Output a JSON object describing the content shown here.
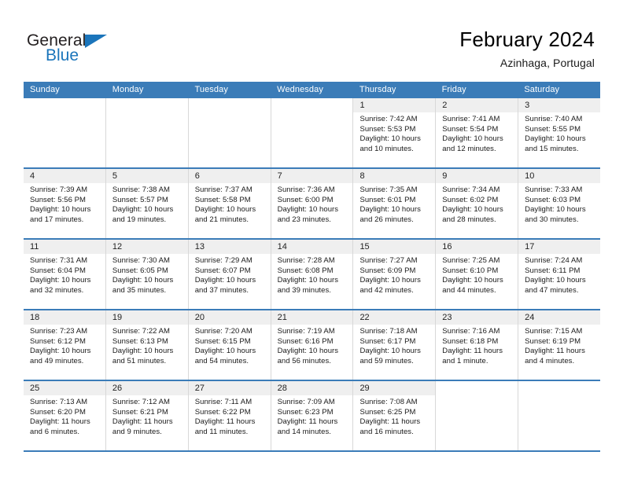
{
  "brand": {
    "name_top": "General",
    "name_bottom": "Blue"
  },
  "header": {
    "title": "February 2024",
    "location": "Azinhaga, Portugal"
  },
  "calendar": {
    "weekday_headers": [
      "Sunday",
      "Monday",
      "Tuesday",
      "Wednesday",
      "Thursday",
      "Friday",
      "Saturday"
    ],
    "colors": {
      "header_blue": "#3b7cb8",
      "daynum_band": "#efefef",
      "brand_blue": "#1b75bb",
      "cell_border": "#d8d8d8"
    },
    "weeks": [
      [
        {
          "day": "",
          "lines": []
        },
        {
          "day": "",
          "lines": []
        },
        {
          "day": "",
          "lines": []
        },
        {
          "day": "",
          "lines": []
        },
        {
          "day": "1",
          "lines": [
            "Sunrise: 7:42 AM",
            "Sunset: 5:53 PM",
            "Daylight: 10 hours and 10 minutes."
          ]
        },
        {
          "day": "2",
          "lines": [
            "Sunrise: 7:41 AM",
            "Sunset: 5:54 PM",
            "Daylight: 10 hours and 12 minutes."
          ]
        },
        {
          "day": "3",
          "lines": [
            "Sunrise: 7:40 AM",
            "Sunset: 5:55 PM",
            "Daylight: 10 hours and 15 minutes."
          ]
        }
      ],
      [
        {
          "day": "4",
          "lines": [
            "Sunrise: 7:39 AM",
            "Sunset: 5:56 PM",
            "Daylight: 10 hours and 17 minutes."
          ]
        },
        {
          "day": "5",
          "lines": [
            "Sunrise: 7:38 AM",
            "Sunset: 5:57 PM",
            "Daylight: 10 hours and 19 minutes."
          ]
        },
        {
          "day": "6",
          "lines": [
            "Sunrise: 7:37 AM",
            "Sunset: 5:58 PM",
            "Daylight: 10 hours and 21 minutes."
          ]
        },
        {
          "day": "7",
          "lines": [
            "Sunrise: 7:36 AM",
            "Sunset: 6:00 PM",
            "Daylight: 10 hours and 23 minutes."
          ]
        },
        {
          "day": "8",
          "lines": [
            "Sunrise: 7:35 AM",
            "Sunset: 6:01 PM",
            "Daylight: 10 hours and 26 minutes."
          ]
        },
        {
          "day": "9",
          "lines": [
            "Sunrise: 7:34 AM",
            "Sunset: 6:02 PM",
            "Daylight: 10 hours and 28 minutes."
          ]
        },
        {
          "day": "10",
          "lines": [
            "Sunrise: 7:33 AM",
            "Sunset: 6:03 PM",
            "Daylight: 10 hours and 30 minutes."
          ]
        }
      ],
      [
        {
          "day": "11",
          "lines": [
            "Sunrise: 7:31 AM",
            "Sunset: 6:04 PM",
            "Daylight: 10 hours and 32 minutes."
          ]
        },
        {
          "day": "12",
          "lines": [
            "Sunrise: 7:30 AM",
            "Sunset: 6:05 PM",
            "Daylight: 10 hours and 35 minutes."
          ]
        },
        {
          "day": "13",
          "lines": [
            "Sunrise: 7:29 AM",
            "Sunset: 6:07 PM",
            "Daylight: 10 hours and 37 minutes."
          ]
        },
        {
          "day": "14",
          "lines": [
            "Sunrise: 7:28 AM",
            "Sunset: 6:08 PM",
            "Daylight: 10 hours and 39 minutes."
          ]
        },
        {
          "day": "15",
          "lines": [
            "Sunrise: 7:27 AM",
            "Sunset: 6:09 PM",
            "Daylight: 10 hours and 42 minutes."
          ]
        },
        {
          "day": "16",
          "lines": [
            "Sunrise: 7:25 AM",
            "Sunset: 6:10 PM",
            "Daylight: 10 hours and 44 minutes."
          ]
        },
        {
          "day": "17",
          "lines": [
            "Sunrise: 7:24 AM",
            "Sunset: 6:11 PM",
            "Daylight: 10 hours and 47 minutes."
          ]
        }
      ],
      [
        {
          "day": "18",
          "lines": [
            "Sunrise: 7:23 AM",
            "Sunset: 6:12 PM",
            "Daylight: 10 hours and 49 minutes."
          ]
        },
        {
          "day": "19",
          "lines": [
            "Sunrise: 7:22 AM",
            "Sunset: 6:13 PM",
            "Daylight: 10 hours and 51 minutes."
          ]
        },
        {
          "day": "20",
          "lines": [
            "Sunrise: 7:20 AM",
            "Sunset: 6:15 PM",
            "Daylight: 10 hours and 54 minutes."
          ]
        },
        {
          "day": "21",
          "lines": [
            "Sunrise: 7:19 AM",
            "Sunset: 6:16 PM",
            "Daylight: 10 hours and 56 minutes."
          ]
        },
        {
          "day": "22",
          "lines": [
            "Sunrise: 7:18 AM",
            "Sunset: 6:17 PM",
            "Daylight: 10 hours and 59 minutes."
          ]
        },
        {
          "day": "23",
          "lines": [
            "Sunrise: 7:16 AM",
            "Sunset: 6:18 PM",
            "Daylight: 11 hours and 1 minute."
          ]
        },
        {
          "day": "24",
          "lines": [
            "Sunrise: 7:15 AM",
            "Sunset: 6:19 PM",
            "Daylight: 11 hours and 4 minutes."
          ]
        }
      ],
      [
        {
          "day": "25",
          "lines": [
            "Sunrise: 7:13 AM",
            "Sunset: 6:20 PM",
            "Daylight: 11 hours and 6 minutes."
          ]
        },
        {
          "day": "26",
          "lines": [
            "Sunrise: 7:12 AM",
            "Sunset: 6:21 PM",
            "Daylight: 11 hours and 9 minutes."
          ]
        },
        {
          "day": "27",
          "lines": [
            "Sunrise: 7:11 AM",
            "Sunset: 6:22 PM",
            "Daylight: 11 hours and 11 minutes."
          ]
        },
        {
          "day": "28",
          "lines": [
            "Sunrise: 7:09 AM",
            "Sunset: 6:23 PM",
            "Daylight: 11 hours and 14 minutes."
          ]
        },
        {
          "day": "29",
          "lines": [
            "Sunrise: 7:08 AM",
            "Sunset: 6:25 PM",
            "Daylight: 11 hours and 16 minutes."
          ]
        },
        {
          "day": "",
          "lines": []
        },
        {
          "day": "",
          "lines": []
        }
      ]
    ]
  }
}
